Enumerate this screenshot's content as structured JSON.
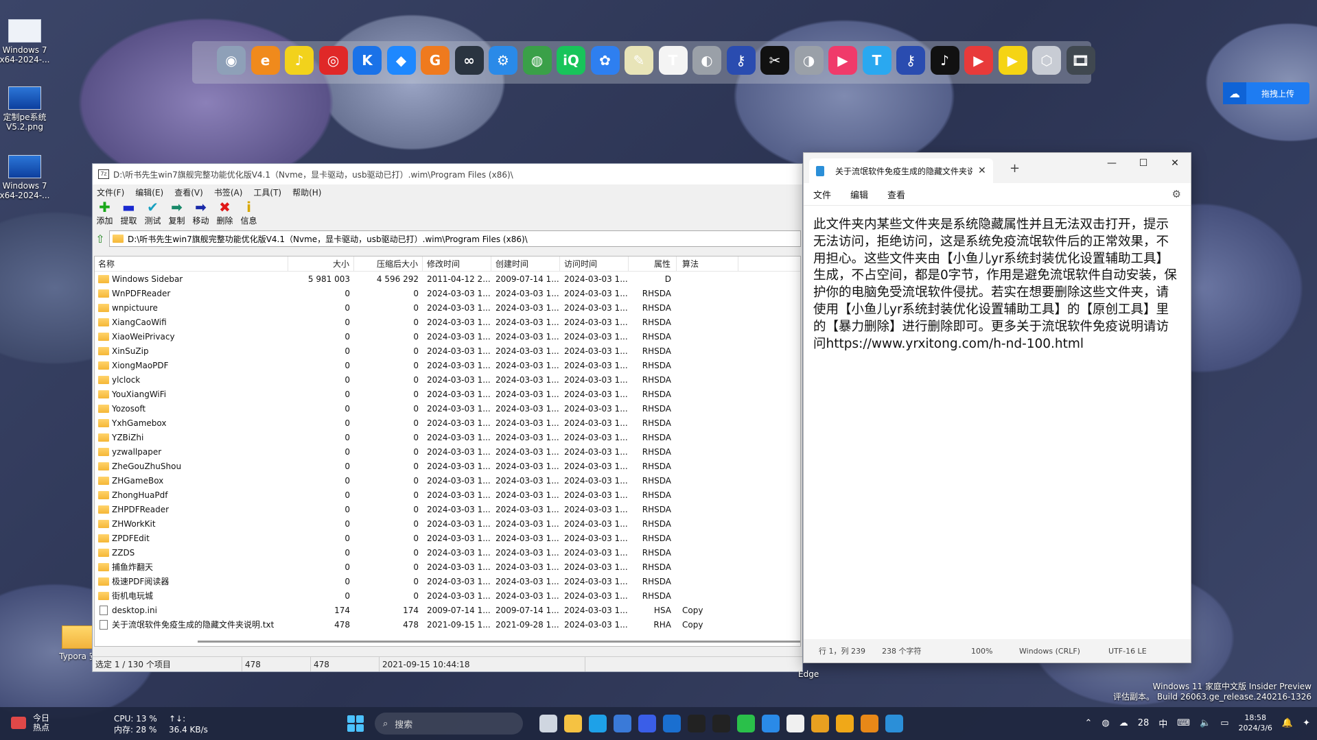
{
  "desktop": {
    "icons": [
      {
        "label": "Windows 7 x64-2024-..."
      },
      {
        "label": "定制pe系统V5.2.png"
      },
      {
        "label": "Windows 7 x64-2024-..."
      },
      {
        "label": "Typora 安"
      }
    ],
    "edge_label": "Edge",
    "upload_label": "拖拽上传",
    "watermark_line1": "Windows 11 家庭中文版 Insider Preview",
    "watermark_line2": "评估副本。 Build 26063.ge_release.240216-1326"
  },
  "dock": {
    "apps": [
      {
        "icon": "record-icon",
        "color": "#8ea0b8",
        "glyph": "◉"
      },
      {
        "icon": "edge-legacy-icon",
        "color": "#f08a1c",
        "glyph": "e"
      },
      {
        "icon": "music-icon",
        "color": "#f2d21c",
        "glyph": "♪"
      },
      {
        "icon": "netease-music-icon",
        "color": "#e02828",
        "glyph": "◎"
      },
      {
        "icon": "kugou-icon",
        "color": "#1a72e8",
        "glyph": "K"
      },
      {
        "icon": "diamond-icon",
        "color": "#1e88ff",
        "glyph": "◆"
      },
      {
        "icon": "g-app-icon",
        "color": "#ef7a1e",
        "glyph": "G"
      },
      {
        "icon": "link-icon",
        "color": "#2a3440",
        "glyph": "∞"
      },
      {
        "icon": "settings-icon",
        "color": "#2a8ae8",
        "glyph": "⚙"
      },
      {
        "icon": "globe-icon",
        "color": "#3aa048",
        "glyph": "◍"
      },
      {
        "icon": "iqiyi-icon",
        "color": "#18c45a",
        "glyph": "iQ"
      },
      {
        "icon": "cloud-icon",
        "color": "#2e7ff0",
        "glyph": "✿"
      },
      {
        "icon": "brush-icon",
        "color": "#e8e4b8",
        "glyph": "✎"
      },
      {
        "icon": "typora-icon",
        "color": "#f4f4f4",
        "glyph": "T"
      },
      {
        "icon": "disk-icon",
        "color": "#9aa0a8",
        "glyph": "◐"
      },
      {
        "icon": "key-icon",
        "color": "#2a4cb0",
        "glyph": "⚷"
      },
      {
        "icon": "capcut-icon",
        "color": "#111111",
        "glyph": "✂"
      },
      {
        "icon": "disk2-icon",
        "color": "#9aa0a8",
        "glyph": "◑"
      },
      {
        "icon": "video-icon",
        "color": "#f03a6a",
        "glyph": "▶"
      },
      {
        "icon": "t-app-icon",
        "color": "#2aa8f0",
        "glyph": "T"
      },
      {
        "icon": "key2-icon",
        "color": "#2a4cb0",
        "glyph": "⚷"
      },
      {
        "icon": "tiktok-icon",
        "color": "#111111",
        "glyph": "♪"
      },
      {
        "icon": "play-store-icon",
        "color": "#e83a3a",
        "glyph": "▶"
      },
      {
        "icon": "player-icon",
        "color": "#f5d414",
        "glyph": "▶"
      },
      {
        "icon": "box-icon",
        "color": "#c8ccd4",
        "glyph": "⬡"
      },
      {
        "icon": "film-icon",
        "color": "#404850",
        "glyph": "🎞"
      }
    ]
  },
  "zip": {
    "title": "D:\\听书先生win7旗舰完整功能优化版V4.1（Nvme，显卡驱动，usb驱动已打）.wim\\Program Files (x86)\\",
    "app_icon_text": "7z",
    "menu": [
      "文件(F)",
      "编辑(E)",
      "查看(V)",
      "书签(A)",
      "工具(T)",
      "帮助(H)"
    ],
    "toolbar": [
      {
        "label": "添加",
        "glyph": "✚",
        "color": "#1aa81a",
        "icon": "add-icon"
      },
      {
        "label": "提取",
        "glyph": "▬",
        "color": "#1a2ad0",
        "icon": "extract-icon"
      },
      {
        "label": "测试",
        "glyph": "✔",
        "color": "#18a0c0",
        "icon": "test-icon"
      },
      {
        "label": "复制",
        "glyph": "➡",
        "color": "#1a8a6a",
        "icon": "copy-icon"
      },
      {
        "label": "移动",
        "glyph": "➡",
        "color": "#1a2aa8",
        "icon": "move-icon"
      },
      {
        "label": "删除",
        "glyph": "✖",
        "color": "#e01818",
        "icon": "delete-icon"
      },
      {
        "label": "信息",
        "glyph": "i",
        "color": "#d8a800",
        "icon": "info-icon"
      }
    ],
    "address": "D:\\听书先生win7旗舰完整功能优化版V4.1（Nvme，显卡驱动，usb驱动已打）.wim\\Program Files (x86)\\",
    "columns": [
      "名称",
      "大小",
      "压缩后大小",
      "修改时间",
      "创建时间",
      "访问时间",
      "属性",
      "算法"
    ],
    "rows": [
      {
        "name": "Windows Sidebar",
        "type": "folder",
        "size": "5 981 003",
        "packed": "4 596 292",
        "mod": "2011-04-12 2...",
        "cre": "2009-07-14 1...",
        "acc": "2024-03-03 1...",
        "attr": "D",
        "meth": ""
      },
      {
        "name": "WnPDFReader",
        "type": "folder",
        "size": "0",
        "packed": "0",
        "mod": "2024-03-03 1...",
        "cre": "2024-03-03 1...",
        "acc": "2024-03-03 1...",
        "attr": "RHSDA",
        "meth": ""
      },
      {
        "name": "wnpictuure",
        "type": "folder",
        "size": "0",
        "packed": "0",
        "mod": "2024-03-03 1...",
        "cre": "2024-03-03 1...",
        "acc": "2024-03-03 1...",
        "attr": "RHSDA",
        "meth": ""
      },
      {
        "name": "XiangCaoWifi",
        "type": "folder",
        "size": "0",
        "packed": "0",
        "mod": "2024-03-03 1...",
        "cre": "2024-03-03 1...",
        "acc": "2024-03-03 1...",
        "attr": "RHSDA",
        "meth": ""
      },
      {
        "name": "XiaoWeiPrivacy",
        "type": "folder",
        "size": "0",
        "packed": "0",
        "mod": "2024-03-03 1...",
        "cre": "2024-03-03 1...",
        "acc": "2024-03-03 1...",
        "attr": "RHSDA",
        "meth": ""
      },
      {
        "name": "XinSuZip",
        "type": "folder",
        "size": "0",
        "packed": "0",
        "mod": "2024-03-03 1...",
        "cre": "2024-03-03 1...",
        "acc": "2024-03-03 1...",
        "attr": "RHSDA",
        "meth": ""
      },
      {
        "name": "XiongMaoPDF",
        "type": "folder",
        "size": "0",
        "packed": "0",
        "mod": "2024-03-03 1...",
        "cre": "2024-03-03 1...",
        "acc": "2024-03-03 1...",
        "attr": "RHSDA",
        "meth": ""
      },
      {
        "name": "ylclock",
        "type": "folder",
        "size": "0",
        "packed": "0",
        "mod": "2024-03-03 1...",
        "cre": "2024-03-03 1...",
        "acc": "2024-03-03 1...",
        "attr": "RHSDA",
        "meth": ""
      },
      {
        "name": "YouXiangWiFi",
        "type": "folder",
        "size": "0",
        "packed": "0",
        "mod": "2024-03-03 1...",
        "cre": "2024-03-03 1...",
        "acc": "2024-03-03 1...",
        "attr": "RHSDA",
        "meth": ""
      },
      {
        "name": "Yozosoft",
        "type": "folder",
        "size": "0",
        "packed": "0",
        "mod": "2024-03-03 1...",
        "cre": "2024-03-03 1...",
        "acc": "2024-03-03 1...",
        "attr": "RHSDA",
        "meth": ""
      },
      {
        "name": "YxhGamebox",
        "type": "folder",
        "size": "0",
        "packed": "0",
        "mod": "2024-03-03 1...",
        "cre": "2024-03-03 1...",
        "acc": "2024-03-03 1...",
        "attr": "RHSDA",
        "meth": ""
      },
      {
        "name": "YZBiZhi",
        "type": "folder",
        "size": "0",
        "packed": "0",
        "mod": "2024-03-03 1...",
        "cre": "2024-03-03 1...",
        "acc": "2024-03-03 1...",
        "attr": "RHSDA",
        "meth": ""
      },
      {
        "name": "yzwallpaper",
        "type": "folder",
        "size": "0",
        "packed": "0",
        "mod": "2024-03-03 1...",
        "cre": "2024-03-03 1...",
        "acc": "2024-03-03 1...",
        "attr": "RHSDA",
        "meth": ""
      },
      {
        "name": "ZheGouZhuShou",
        "type": "folder",
        "size": "0",
        "packed": "0",
        "mod": "2024-03-03 1...",
        "cre": "2024-03-03 1...",
        "acc": "2024-03-03 1...",
        "attr": "RHSDA",
        "meth": ""
      },
      {
        "name": "ZHGameBox",
        "type": "folder",
        "size": "0",
        "packed": "0",
        "mod": "2024-03-03 1...",
        "cre": "2024-03-03 1...",
        "acc": "2024-03-03 1...",
        "attr": "RHSDA",
        "meth": ""
      },
      {
        "name": "ZhongHuaPdf",
        "type": "folder",
        "size": "0",
        "packed": "0",
        "mod": "2024-03-03 1...",
        "cre": "2024-03-03 1...",
        "acc": "2024-03-03 1...",
        "attr": "RHSDA",
        "meth": ""
      },
      {
        "name": "ZHPDFReader",
        "type": "folder",
        "size": "0",
        "packed": "0",
        "mod": "2024-03-03 1...",
        "cre": "2024-03-03 1...",
        "acc": "2024-03-03 1...",
        "attr": "RHSDA",
        "meth": ""
      },
      {
        "name": "ZHWorkKit",
        "type": "folder",
        "size": "0",
        "packed": "0",
        "mod": "2024-03-03 1...",
        "cre": "2024-03-03 1...",
        "acc": "2024-03-03 1...",
        "attr": "RHSDA",
        "meth": ""
      },
      {
        "name": "ZPDFEdit",
        "type": "folder",
        "size": "0",
        "packed": "0",
        "mod": "2024-03-03 1...",
        "cre": "2024-03-03 1...",
        "acc": "2024-03-03 1...",
        "attr": "RHSDA",
        "meth": ""
      },
      {
        "name": "ZZDS",
        "type": "folder",
        "size": "0",
        "packed": "0",
        "mod": "2024-03-03 1...",
        "cre": "2024-03-03 1...",
        "acc": "2024-03-03 1...",
        "attr": "RHSDA",
        "meth": ""
      },
      {
        "name": "捕鱼炸翻天",
        "type": "folder",
        "size": "0",
        "packed": "0",
        "mod": "2024-03-03 1...",
        "cre": "2024-03-03 1...",
        "acc": "2024-03-03 1...",
        "attr": "RHSDA",
        "meth": ""
      },
      {
        "name": "极速PDF阅读器",
        "type": "folder",
        "size": "0",
        "packed": "0",
        "mod": "2024-03-03 1...",
        "cre": "2024-03-03 1...",
        "acc": "2024-03-03 1...",
        "attr": "RHSDA",
        "meth": ""
      },
      {
        "name": "街机电玩城",
        "type": "folder",
        "size": "0",
        "packed": "0",
        "mod": "2024-03-03 1...",
        "cre": "2024-03-03 1...",
        "acc": "2024-03-03 1...",
        "attr": "RHSDA",
        "meth": ""
      },
      {
        "name": "desktop.ini",
        "type": "file",
        "size": "174",
        "packed": "174",
        "mod": "2009-07-14 1...",
        "cre": "2009-07-14 1...",
        "acc": "2024-03-03 1...",
        "attr": "HSA",
        "meth": "Copy"
      },
      {
        "name": "关于流氓软件免疫生成的隐藏文件夹说明.txt",
        "type": "file",
        "size": "478",
        "packed": "478",
        "mod": "2021-09-15 1...",
        "cre": "2021-09-28 1...",
        "acc": "2024-03-03 1...",
        "attr": "RHA",
        "meth": "Copy"
      }
    ],
    "status": {
      "selection": "选定 1 / 130 个项目",
      "size": "478",
      "packed": "478",
      "modified": "2021-09-15 10:44:18"
    }
  },
  "notepad": {
    "tab_title": "关于流氓软件免疫生成的隐藏文件夹说明",
    "tab_close": "✕",
    "new_tab": "+",
    "win_min": "—",
    "win_max": "☐",
    "win_close": "✕",
    "menu": [
      "文件",
      "编辑",
      "查看"
    ],
    "content": "此文件夹内某些文件夹是系统隐藏属性并且无法双击打开，提示无法访问，拒绝访问，这是系统免疫流氓软件后的正常效果，不用担心。这些文件夹由【小鱼儿yr系统封装优化设置辅助工具】生成，不占空间，都是0字节，作用是避免流氓软件自动安装，保护你的电脑免受流氓软件侵扰。若实在想要删除这些文件夹，请使用【小鱼儿yr系统封装优化设置辅助工具】的【原创工具】里的【暴力删除】进行删除即可。更多关于流氓软件免疫说明请访问https://www.yrxitong.com/h-nd-100.html",
    "status": {
      "position": "行 1，列 239",
      "chars": "238 个字符",
      "zoom": "100%",
      "line_ending": "Windows (CRLF)",
      "encoding": "UTF-16 LE"
    }
  },
  "taskbar": {
    "widget_line1": "今日",
    "widget_line2": "热点",
    "cpu": "CPU: 13 %",
    "mem": "内存: 28 %",
    "net_arrows": "↑↓:",
    "net_speed": "36.4 KB/s",
    "search_placeholder": "搜索",
    "tray_temp": "28",
    "tray_ime": "中",
    "time": "18:58",
    "date": "2024/3/6",
    "pinned": [
      {
        "icon": "task-view-icon",
        "color": "#cfd6e0"
      },
      {
        "icon": "file-explorer-icon",
        "color": "#f5c242"
      },
      {
        "icon": "edge-icon",
        "color": "#1ea1e8"
      },
      {
        "icon": "store-icon",
        "color": "#3a7ad8"
      },
      {
        "icon": "pen-app-icon",
        "color": "#3a5ee8"
      },
      {
        "icon": "outlook-icon",
        "color": "#1a6fd0"
      },
      {
        "icon": "qq-icon",
        "color": "#222222"
      },
      {
        "icon": "qq2-icon",
        "color": "#222222"
      },
      {
        "icon": "wechat-icon",
        "color": "#2ac04a"
      },
      {
        "icon": "bookmark-app-icon",
        "color": "#2a8ae8"
      },
      {
        "icon": "sevenzip-icon",
        "color": "#f0f0f0"
      },
      {
        "icon": "ring-app-icon",
        "color": "#e8a020"
      },
      {
        "icon": "bolt-app-icon",
        "color": "#f0a818"
      },
      {
        "icon": "window-app-icon",
        "color": "#e88818"
      },
      {
        "icon": "notepad-icon",
        "color": "#2b8fd8"
      }
    ]
  }
}
